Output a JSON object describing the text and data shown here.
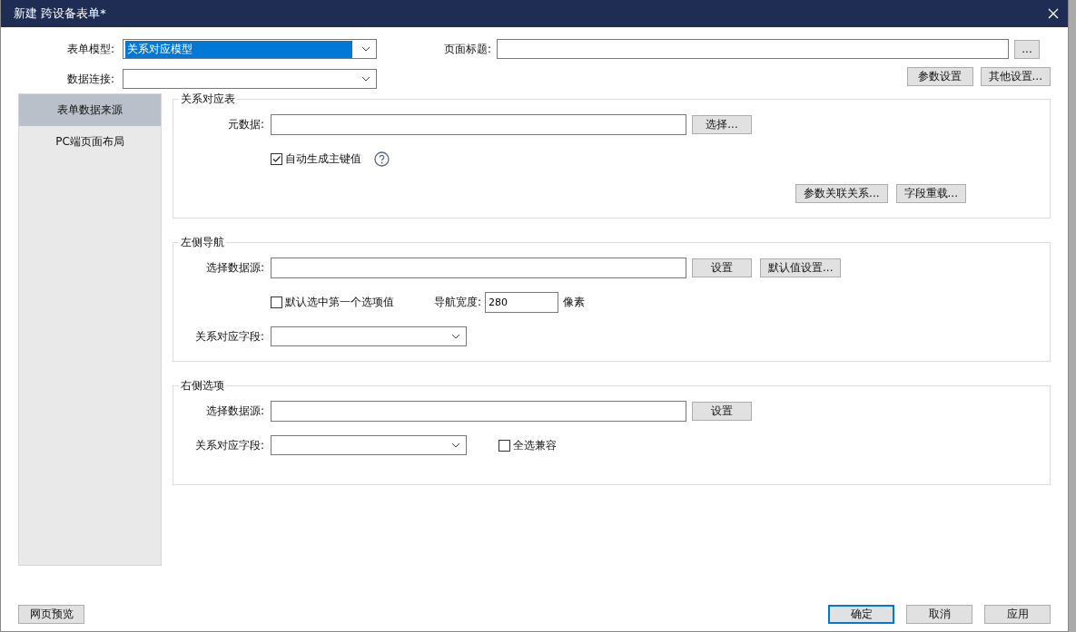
{
  "window": {
    "title": "新建 跨设备表单*"
  },
  "top": {
    "model_label": "表单模型:",
    "model_value": "关系对应模型",
    "page_title_label": "页面标题:",
    "page_title_button": "...",
    "connection_label": "数据连接:",
    "buttons": [
      "参数设置",
      "其他设置..."
    ]
  },
  "sidebar": {
    "items": [
      {
        "label": "表单数据来源",
        "selected": true
      },
      {
        "label": "PC端页面布局",
        "selected": false
      }
    ]
  },
  "groups": [
    {
      "title": "关系对应表",
      "rows": [
        {
          "kind": "fields",
          "items": [
            {
              "kind": "label",
              "text": "元数据:"
            },
            {
              "kind": "input"
            },
            {
              "kind": "button",
              "text": "选择..."
            }
          ]
        },
        {
          "kind": "fields",
          "items": [
            {
              "kind": "spacer"
            },
            {
              "kind": "checkbox",
              "text": "自动生成主键值",
              "checked": true
            },
            {
              "kind": "help"
            }
          ]
        },
        {
          "kind": "actions",
          "items": [
            {
              "kind": "button",
              "text": "参数关联关系..."
            },
            {
              "kind": "button",
              "text": "字段重载..."
            }
          ]
        }
      ]
    },
    {
      "title": "左侧导航",
      "rows": [
        {
          "kind": "fields",
          "items": [
            {
              "kind": "label",
              "text": "选择数据源:"
            },
            {
              "kind": "input"
            },
            {
              "kind": "button",
              "text": "设置"
            },
            {
              "kind": "button",
              "text": "默认值设置..."
            }
          ]
        },
        {
          "kind": "fields",
          "items": [
            {
              "kind": "spacer"
            },
            {
              "kind": "checkbox",
              "text": "默认选中第一个选项值",
              "checked": false
            },
            {
              "kind": "label",
              "text": "导航宽度:"
            },
            {
              "kind": "small-input",
              "value": "280"
            },
            {
              "kind": "text",
              "text": "像素"
            }
          ]
        },
        {
          "kind": "fields",
          "items": [
            {
              "kind": "label",
              "text": "关系对应字段:"
            },
            {
              "kind": "combo"
            }
          ]
        }
      ]
    },
    {
      "title": "右侧选项",
      "rows": [
        {
          "kind": "fields",
          "items": [
            {
              "kind": "label",
              "text": "选择数据源:"
            },
            {
              "kind": "input"
            },
            {
              "kind": "button",
              "text": "设置"
            }
          ]
        },
        {
          "kind": "fields",
          "items": [
            {
              "kind": "label",
              "text": "关系对应字段:"
            },
            {
              "kind": "combo"
            },
            {
              "kind": "checkbox",
              "text": "全选兼容",
              "checked": false
            }
          ]
        }
      ]
    }
  ],
  "footer": {
    "left_button": "网页预览",
    "buttons": [
      {
        "label": "确定",
        "default": true
      },
      {
        "label": "取消",
        "default": false
      },
      {
        "label": "应用",
        "default": false
      }
    ]
  }
}
